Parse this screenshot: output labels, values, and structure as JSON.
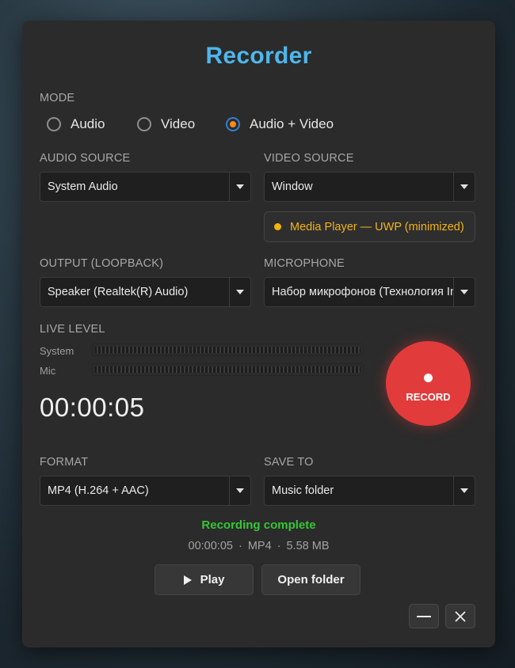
{
  "app": {
    "title": "Recorder"
  },
  "mode": {
    "label": "MODE",
    "options": [
      "Audio",
      "Video",
      "Audio + Video"
    ],
    "selected": "Audio + Video"
  },
  "audio_source": {
    "label": "AUDIO SOURCE",
    "value": "System Audio"
  },
  "video_source": {
    "label": "VIDEO SOURCE",
    "value": "Window",
    "window_status": "Media Player — UWP (minimized)"
  },
  "output": {
    "label": "OUTPUT (LOOPBACK)",
    "value": "Speaker (Realtek(R) Audio)"
  },
  "microphone": {
    "label": "MICROPHONE",
    "value": "Набор микрофонов (Технология Intel® Smart Sound)"
  },
  "live_level": {
    "label": "LIVE LEVEL",
    "system_label": "System",
    "mic_label": "Mic",
    "system_level": 0,
    "mic_level": 0
  },
  "timer": "00:00:05",
  "record_button": {
    "label": "RECORD"
  },
  "format": {
    "label": "FORMAT",
    "value": "MP4 (H.264 + AAC)"
  },
  "save_to": {
    "label": "SAVE TO",
    "value": "Music folder"
  },
  "status": {
    "message": "Recording complete",
    "duration": "00:00:05",
    "format": "MP4",
    "size": "5.58 MB",
    "separator": "·"
  },
  "actions": {
    "play_label": "Play",
    "open_folder_label": "Open folder"
  },
  "colors": {
    "accent_title": "#4fb6ea",
    "record_red": "#e23b3b",
    "success_green": "#35c735",
    "warning_amber": "#f2b319",
    "radio_selected_dot": "#f5891c"
  },
  "icons": {
    "radio": "radio-circle-icon",
    "dropdown": "chevron-down-icon",
    "status_dot": "status-dot-icon",
    "record": "record-dot-icon",
    "play": "play-icon",
    "minimize": "minimize-icon",
    "close": "close-icon"
  }
}
